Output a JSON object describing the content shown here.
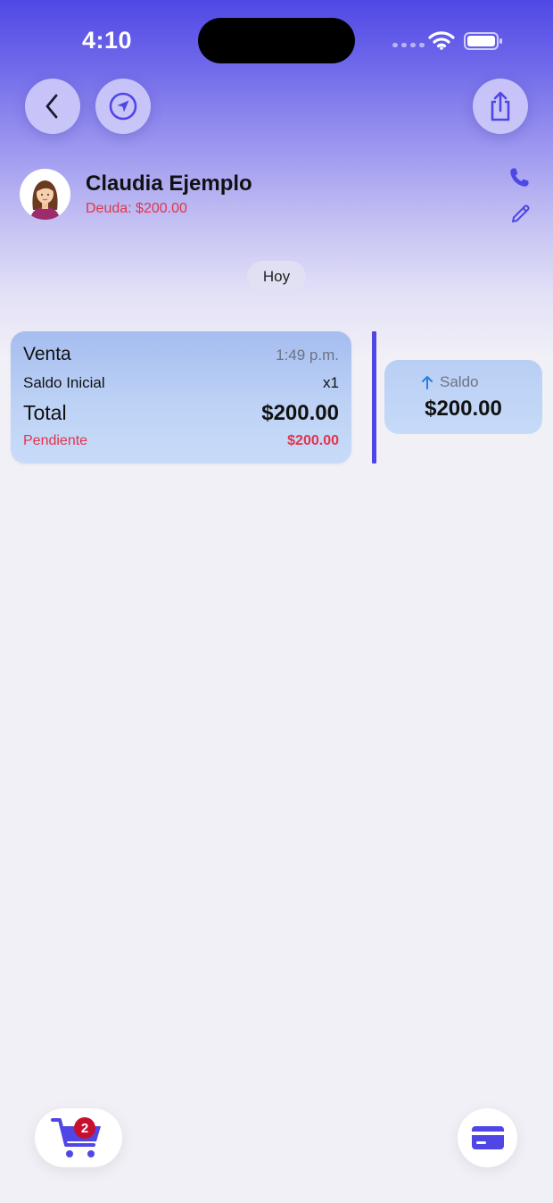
{
  "status_bar": {
    "time": "4:10"
  },
  "client": {
    "name": "Claudia Ejemplo",
    "debt": "Deuda: $200.00"
  },
  "date_label": "Hoy",
  "sale": {
    "type": "Venta",
    "time": "1:49 p.m.",
    "item_name": "Saldo Inicial",
    "item_qty": "x1",
    "total_label": "Total",
    "total_value": "$200.00",
    "status_label": "Pendiente",
    "status_amount": "$200.00"
  },
  "balance": {
    "label": "Saldo",
    "value": "$200.00"
  },
  "cart": {
    "badge_count": "2"
  },
  "colors": {
    "accent": "#4f46e5",
    "debt_red": "#e5334b",
    "badge_red": "#c8102e",
    "card_blue": "#bdd2f5"
  },
  "icons": {
    "back": "chevron-left-icon",
    "location": "location-arrow-icon",
    "share": "share-icon",
    "phone": "phone-icon",
    "edit": "pencil-icon",
    "balance_arrow": "arrow-up-icon",
    "cart": "cart-icon",
    "card": "credit-card-icon"
  }
}
